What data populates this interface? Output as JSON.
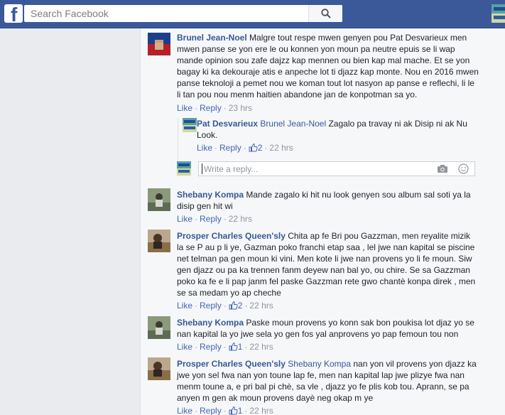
{
  "header": {
    "logo": "f",
    "search_placeholder": "Search Facebook"
  },
  "reply_box": {
    "placeholder": "Write a reply..."
  },
  "comments": [
    {
      "author": "Brunel Jean-Noel",
      "text": "Malgre tout respe mwen genyen pou Pat Desvarieux men mwen panse se yon ere le ou konnen yon moun pa neutre epuis se li wap mande opinion sou zafe dajzz kap mennen ou bien kap mal mache. Et se yon bagay ki ka dekouraje atis e anpeche lot ti djazz kap monte. Nou en 2016 mwen panse teknoloji a pemet nou we koman tout lot nasyon ap panse e reflechi, li le li tan pou nou menm haitien abandone jan de konpotman sa yo.",
      "like": "Like",
      "reply": "Reply",
      "time": "23 hrs"
    },
    {
      "author": "Pat Desvarieux",
      "tag": "Brunel Jean-Noel",
      "text": "Zagalo pa travay ni ak Disip ni ak Nu Look.",
      "like": "Like",
      "reply": "Reply",
      "likes": "2",
      "time": "22 hrs"
    },
    {
      "author": "Shebany Kompa",
      "text": "Mande zagalo ki hit nu look genyen sou album sal soti ya la disip gen hit wi",
      "like": "Like",
      "reply": "Reply",
      "time": "22 hrs"
    },
    {
      "author": "Prosper Charles Queen'sly",
      "text": "Chita ap fe Bri pou Gazzman, men reyalite mizik la se P au p li ye, Gazman poko franchi etap saa , lel jwe nan kapital se piscine net telman pa gen moun ki vini. Men kote li jwe nan provens yo li fe moun. Siw gen djazz ou pa ka trennen fanm deyew nan bal yo, ou chire. Se sa Gazzman poko ka fe e li pap janm fel paske Gazzman rete gwo chantè konpa direk , men se sa medam yo ap cheche",
      "like": "Like",
      "reply": "Reply",
      "likes": "2",
      "time": "22 hrs"
    },
    {
      "author": "Shebany Kompa",
      "text": "Paske moun provens yo konn sak bon poukisa lot djaz yo se nan kapital la yo jwe sela yo gen fos yal anprovens yo pap femoun tou non",
      "like": "Like",
      "reply": "Reply",
      "likes": "1",
      "time": "22 hrs"
    },
    {
      "author": "Prosper Charles Queen'sly",
      "tag": "Shebany Kompa",
      "text": "nan yon vil provens yon djazz ka jwe yon sel fwa nan yon toune lap fe, men nan kapital lap jwe plizye fwa nan menm toune a, e pri bal pi chè, sa vle , djazz yo fe plis kob tou. Aprann, se pa anyen m gen ak moun provens dayè neg okap m ye",
      "like": "Like",
      "reply": "Reply",
      "likes": "1",
      "time": "22 hrs"
    }
  ],
  "colors": {
    "facebook_blue": "#3b5998",
    "link_blue": "#365899",
    "action_blue": "#4267b2",
    "meta_gray": "#90949c"
  }
}
